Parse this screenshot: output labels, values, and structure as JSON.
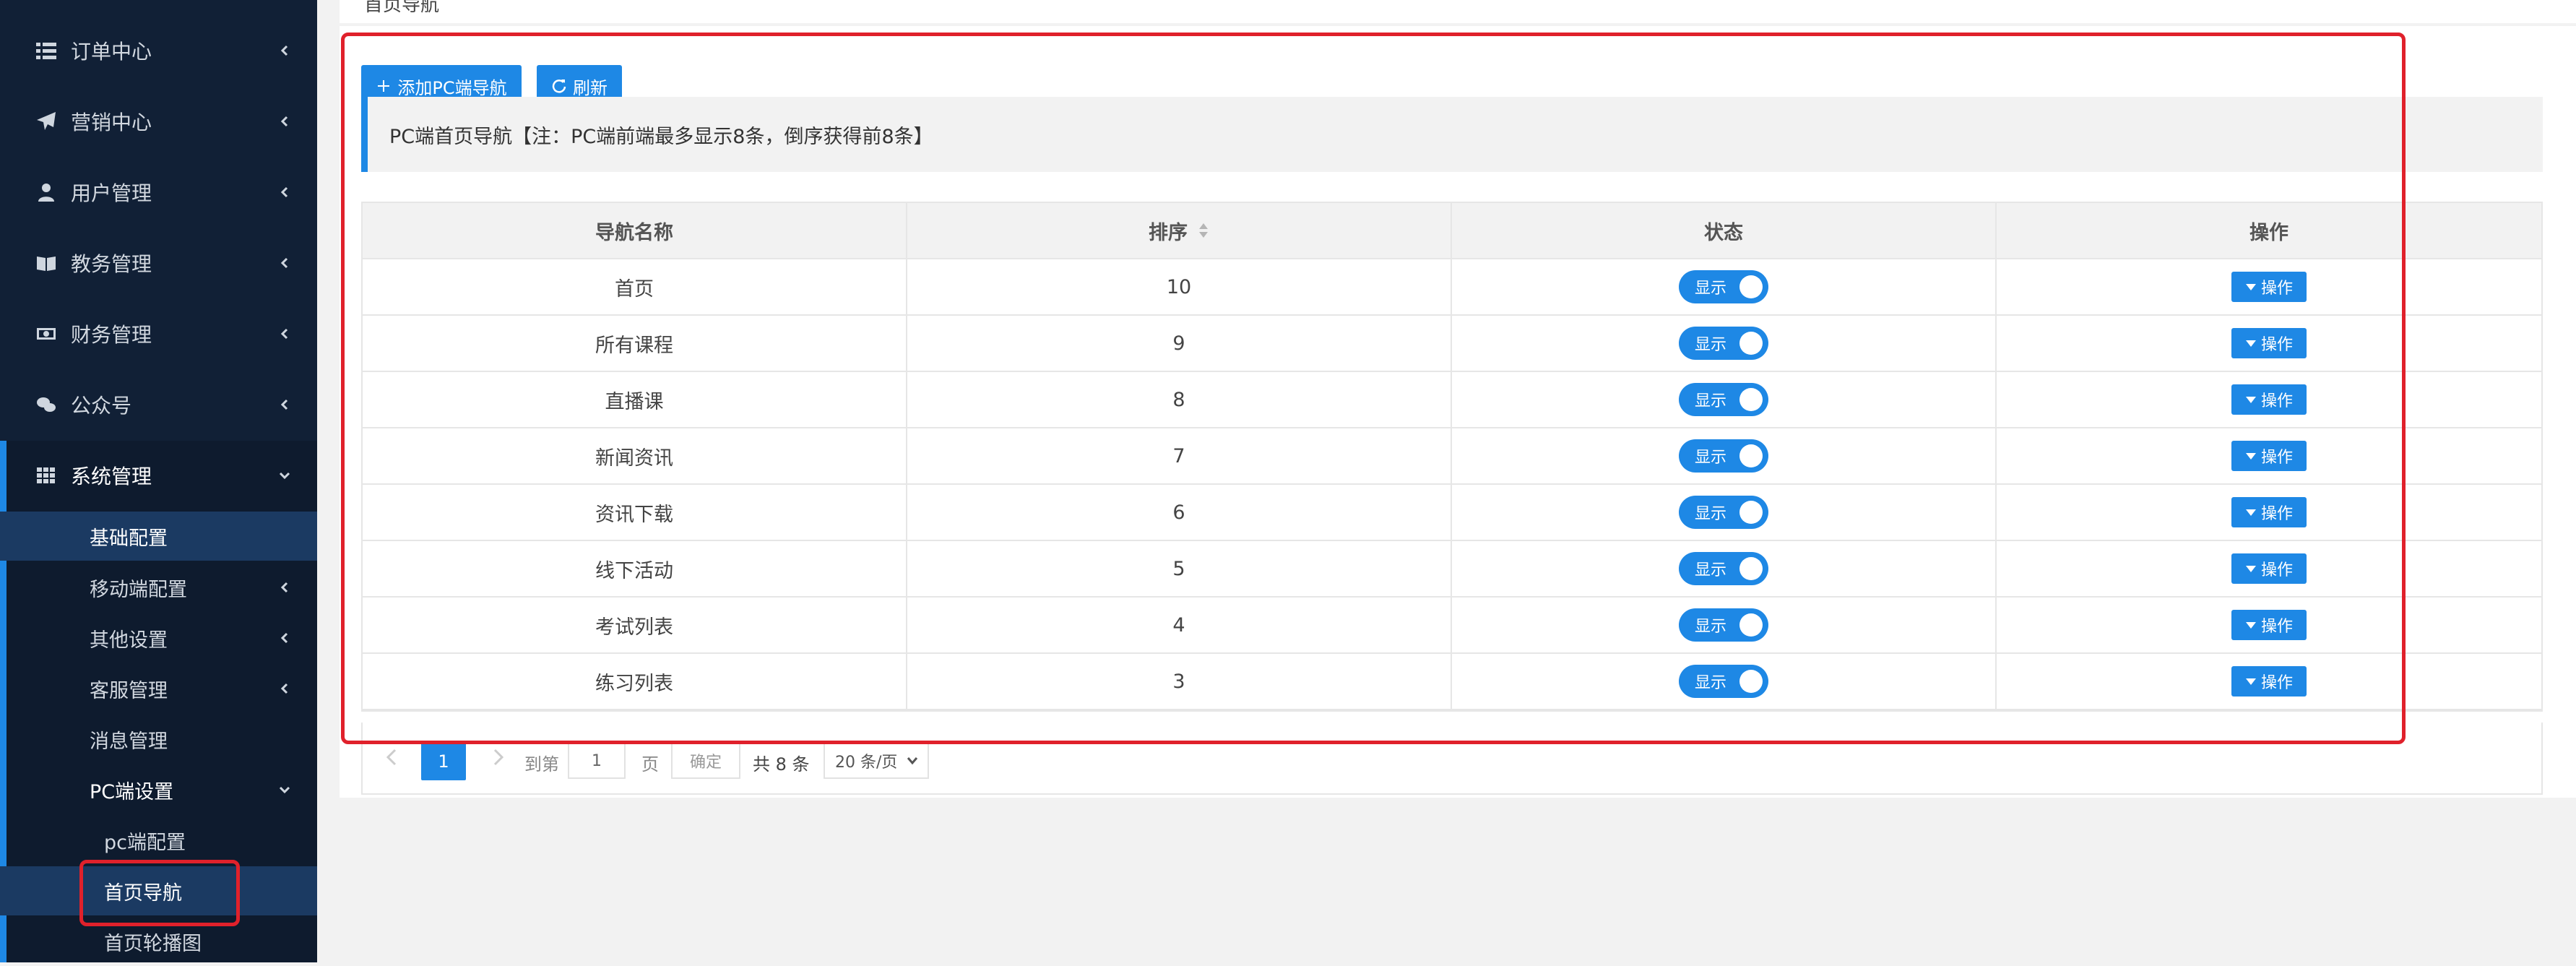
{
  "sidebar": {
    "menu": [
      {
        "label": "订单中心",
        "icon": "list-icon"
      },
      {
        "label": "营销中心",
        "icon": "paper-plane-icon"
      },
      {
        "label": "用户管理",
        "icon": "user-icon"
      },
      {
        "label": "教务管理",
        "icon": "book-icon"
      },
      {
        "label": "财务管理",
        "icon": "money-icon"
      },
      {
        "label": "公众号",
        "icon": "wechat-icon"
      },
      {
        "label": "系统管理",
        "icon": "grid-icon"
      }
    ],
    "sub": [
      {
        "label": "基础配置"
      },
      {
        "label": "移动端配置"
      },
      {
        "label": "其他设置"
      },
      {
        "label": "客服管理"
      },
      {
        "label": "消息管理"
      },
      {
        "label": "PC端设置"
      },
      {
        "label": "pc端配置"
      },
      {
        "label": "首页导航"
      },
      {
        "label": "首页轮播图"
      }
    ]
  },
  "page": {
    "breadcrumb": "首页导航",
    "add_button": "添加PC端导航",
    "refresh_button": "刷新",
    "notice": "PC端首页导航【注：PC端前端最多显示8条，倒序获得前8条】"
  },
  "table": {
    "headers": [
      "导航名称",
      "排序",
      "状态",
      "操作"
    ],
    "rows": [
      {
        "name": "首页",
        "sort": "10",
        "status": "显示",
        "op": "操作"
      },
      {
        "name": "所有课程",
        "sort": "9",
        "status": "显示",
        "op": "操作"
      },
      {
        "name": "直播课",
        "sort": "8",
        "status": "显示",
        "op": "操作"
      },
      {
        "name": "新闻资讯",
        "sort": "7",
        "status": "显示",
        "op": "操作"
      },
      {
        "name": "资讯下载",
        "sort": "6",
        "status": "显示",
        "op": "操作"
      },
      {
        "name": "线下活动",
        "sort": "5",
        "status": "显示",
        "op": "操作"
      },
      {
        "name": "考试列表",
        "sort": "4",
        "status": "显示",
        "op": "操作"
      },
      {
        "name": "练习列表",
        "sort": "3",
        "status": "显示",
        "op": "操作"
      }
    ]
  },
  "pager": {
    "current": "1",
    "goto_label": "到第",
    "page_input": "1",
    "page_unit": "页",
    "confirm": "确定",
    "total": "共 8 条",
    "per_page": "20 条/页"
  },
  "colors": {
    "sidebar_bg": "#112036",
    "accent": "#1e88e5",
    "annotation": "#e0212b"
  }
}
